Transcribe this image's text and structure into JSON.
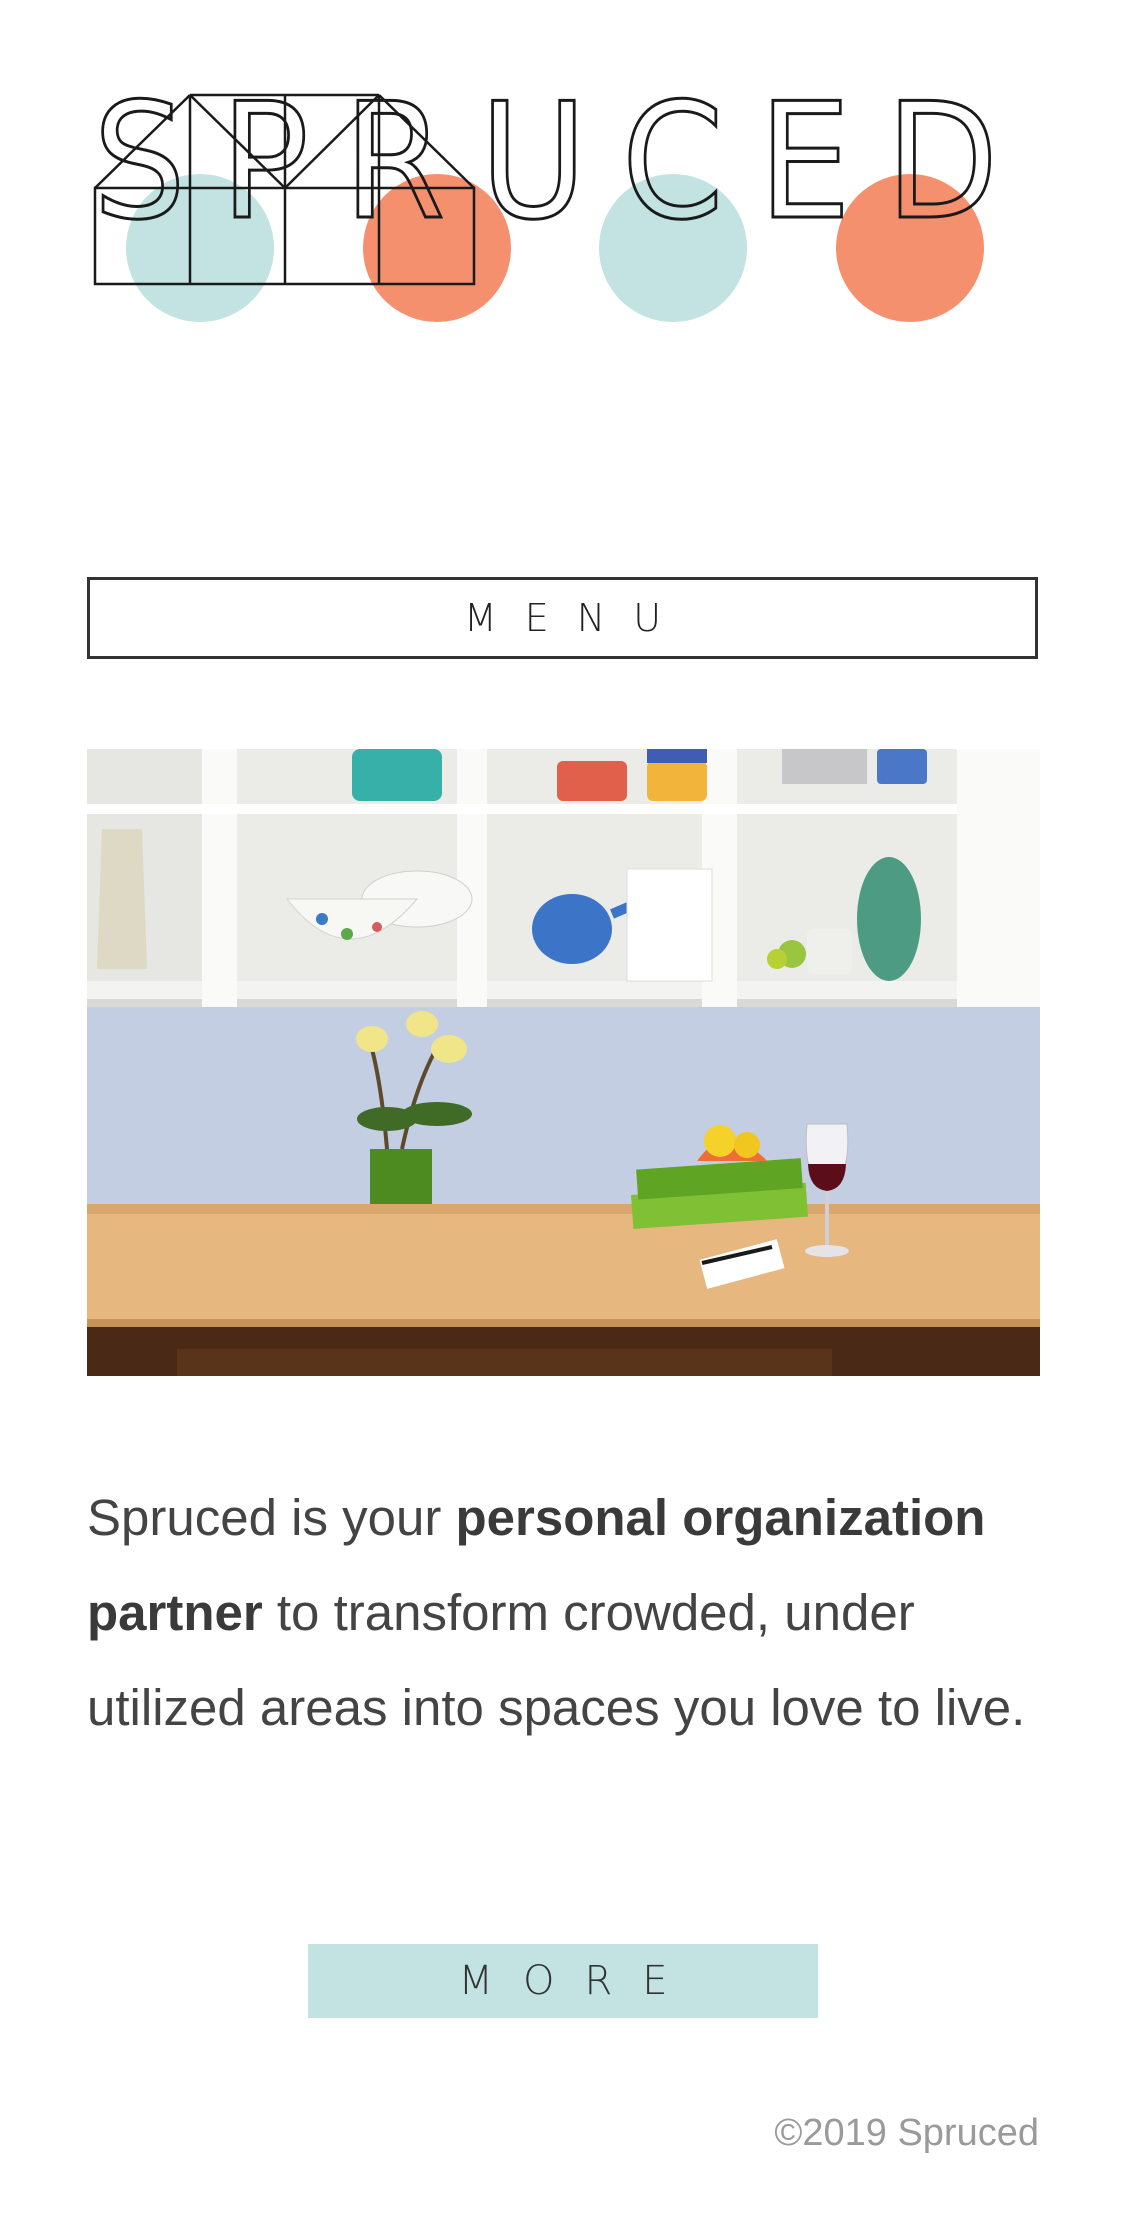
{
  "brand": {
    "name": "SPRUCED",
    "logo_icon": "house-outline-icon",
    "dot_colors": [
      "#c2e3e2",
      "#f5906f",
      "#c2e3e2",
      "#f5906f"
    ]
  },
  "nav": {
    "menu_label": "MENU"
  },
  "hero": {
    "image_icon": "kitchen-cabinets-photo"
  },
  "intro": {
    "text_before": "Spruced is your ",
    "text_bold": "personal organization partner",
    "text_after": " to transform crowded, under utilized areas into spaces you love to live."
  },
  "cta": {
    "more_label": "MORE"
  },
  "footer": {
    "copyright": "©2019 Spruced"
  },
  "colors": {
    "accent_teal": "#c2e3e2",
    "accent_coral": "#f5906f",
    "text": "#444444"
  }
}
